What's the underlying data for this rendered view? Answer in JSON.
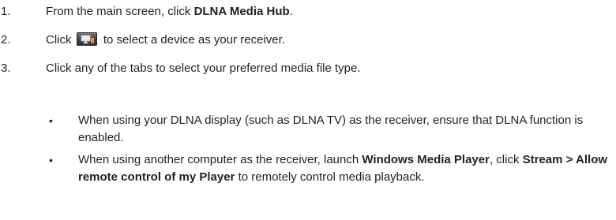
{
  "steps": [
    {
      "number": "1.",
      "before": "From the main screen, click ",
      "bold": "DLNA Media Hub",
      "after": "."
    },
    {
      "number": "2.",
      "before": "Click ",
      "icon": "device-select-icon",
      "after": " to select a device as your receiver."
    },
    {
      "number": "3.",
      "text": "Click any of the tabs to select your preferred media file type."
    }
  ],
  "notes": [
    {
      "bullet": "•",
      "text": "When using your DLNA display (such as DLNA TV) as the receiver, ensure that DLNA function is enabled."
    },
    {
      "bullet": "•",
      "part1": "When using another computer as the receiver, launch ",
      "bold1": "Windows Media Player",
      "part2": ", click ",
      "bold2": "Stream > Allow remote control of my Player",
      "part3": " to remotely control media playback."
    }
  ]
}
